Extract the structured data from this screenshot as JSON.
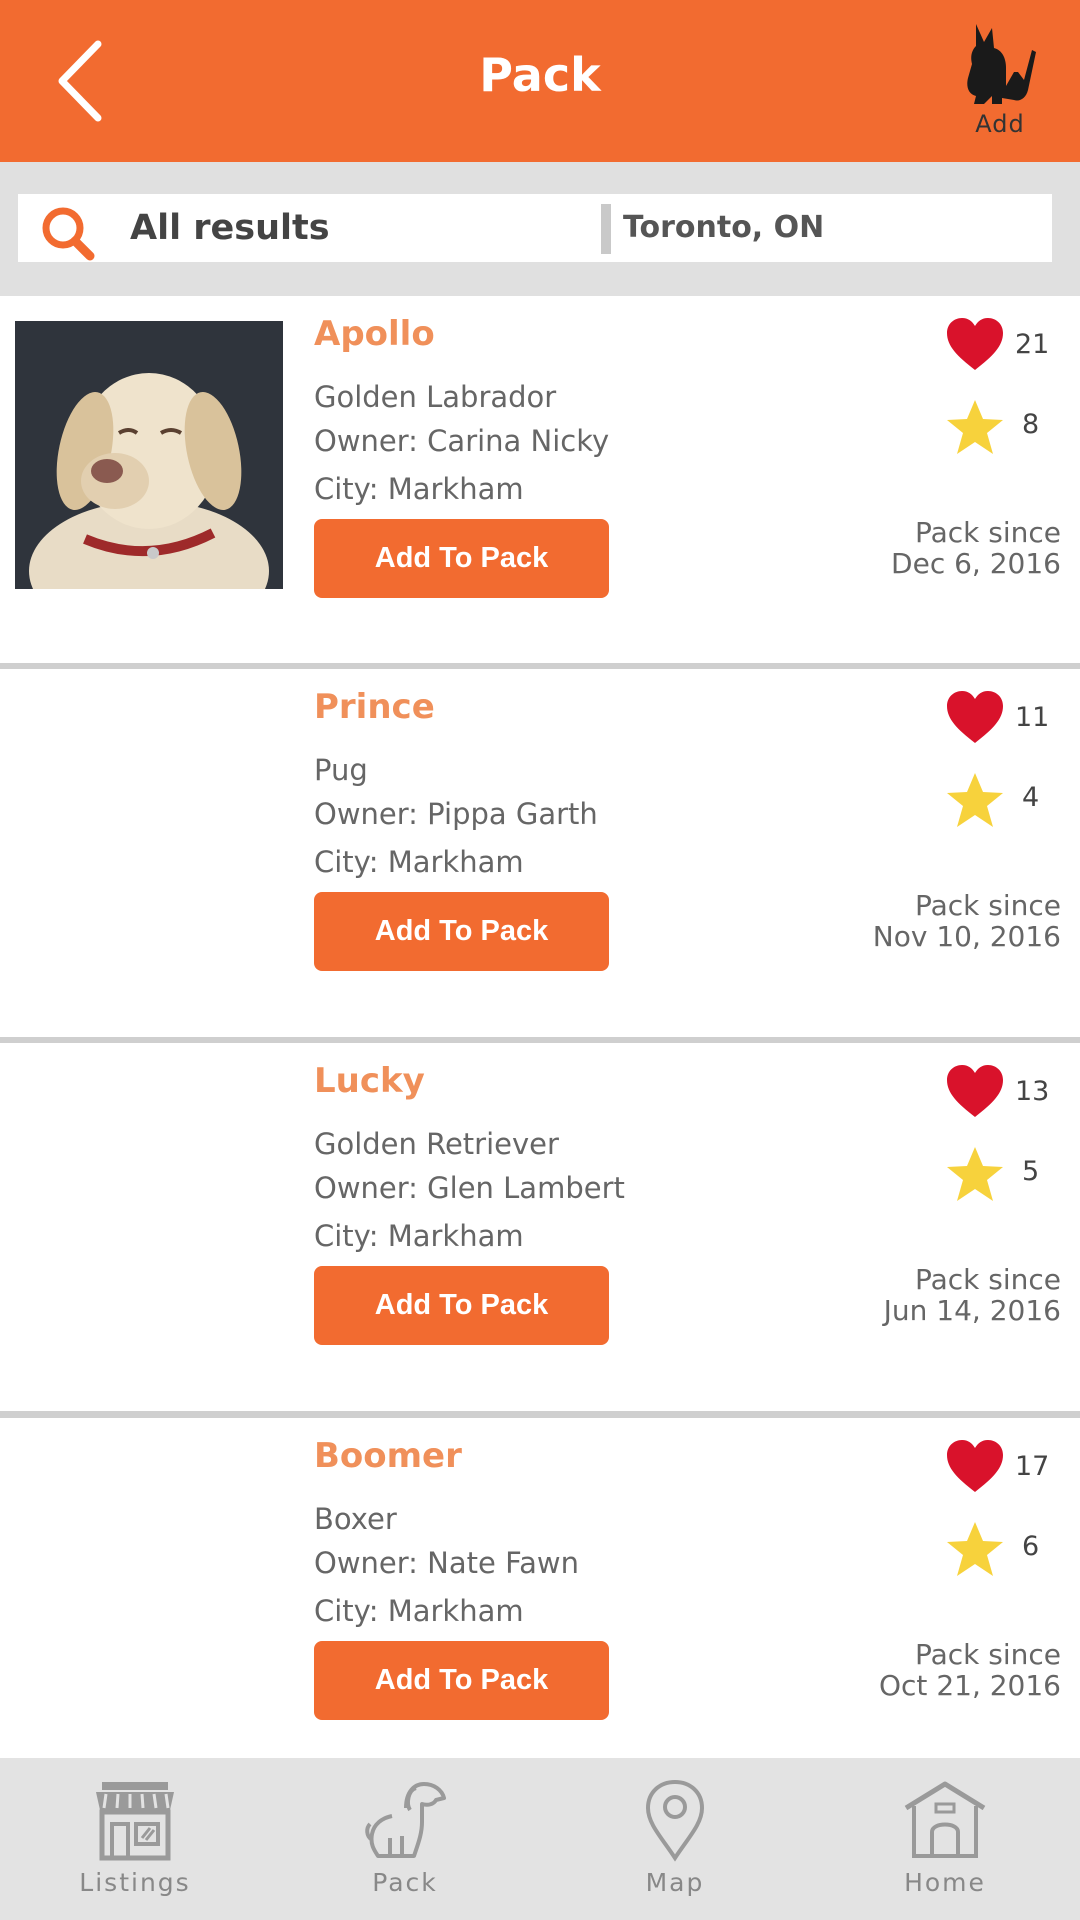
{
  "header": {
    "title": "Pack",
    "back_icon": "chevron-left-icon",
    "add_label": "Add",
    "add_icon": "dog-add-icon"
  },
  "search": {
    "query": "All results",
    "location": "Toronto, ON",
    "icon": "search-icon"
  },
  "listings": [
    {
      "name": "Apollo",
      "breed": "Golden Labrador",
      "owner": "Owner: Carina Nicky",
      "city": "City: Markham",
      "button": "Add To Pack",
      "likes": "21",
      "stars": "8",
      "since_label": "Pack since",
      "since_date": "Dec 6, 2016",
      "has_photo": true
    },
    {
      "name": "Prince",
      "breed": "Pug",
      "owner": "Owner: Pippa Garth",
      "city": "City: Markham",
      "button": "Add To Pack",
      "likes": "11",
      "stars": "4",
      "since_label": "Pack since",
      "since_date": "Nov 10, 2016",
      "has_photo": false
    },
    {
      "name": "Lucky",
      "breed": "Golden Retriever",
      "owner": "Owner: Glen Lambert",
      "city": "City: Markham",
      "button": "Add To Pack",
      "likes": "13",
      "stars": "5",
      "since_label": "Pack since",
      "since_date": "Jun 14, 2016",
      "has_photo": false
    },
    {
      "name": "Boomer",
      "breed": "Boxer",
      "owner": "Owner: Nate Fawn",
      "city": "City: Markham",
      "button": "Add To Pack",
      "likes": "17",
      "stars": "6",
      "since_label": "Pack since",
      "since_date": "Oct 21, 2016",
      "has_photo": false
    }
  ],
  "nav": [
    {
      "label": "Listings",
      "icon": "storefront-icon"
    },
    {
      "label": "Pack",
      "icon": "dog-icon"
    },
    {
      "label": "Map",
      "icon": "map-pin-icon"
    },
    {
      "label": "Home",
      "icon": "doghouse-icon"
    }
  ],
  "colors": {
    "accent": "#f26b30",
    "name": "#f0905a",
    "heart": "#d9122b",
    "star": "#f7d23c",
    "nav_bg": "#e3e3e3",
    "search_bg": "#e0e0e0"
  }
}
